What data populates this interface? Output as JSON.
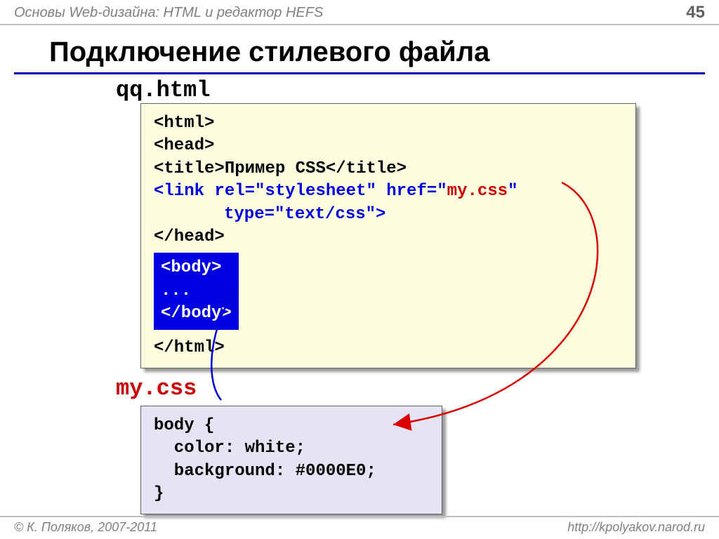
{
  "header": {
    "course": "Основы Web-дизайна: HTML и редактор HEFS",
    "page": "45"
  },
  "title": "Подключение стилевого файла",
  "html_file": {
    "name": "qq.html",
    "line_html": "<html>",
    "line_head": "<head>",
    "line_title_open": "<title>",
    "line_title_text": "Пример CSS",
    "line_title_close": "</title>",
    "link_part1": "<link rel=\"stylesheet\" href=\"",
    "link_part2": "my.css",
    "link_part3": "\"",
    "link_part4": "type=\"text/css\">",
    "line_head_close": "</head>",
    "body_open": "<body>",
    "body_dots": "...",
    "body_close": "</body>",
    "line_html_close": "</html>"
  },
  "css_file": {
    "name": "my.css",
    "l1": "body {",
    "l2": "  color: white;",
    "l3": "  background: #0000E0;",
    "l4": "}"
  },
  "footer": {
    "copyright": "© К. Поляков, 2007-2011",
    "url": "http://kpolyakov.narod.ru"
  }
}
